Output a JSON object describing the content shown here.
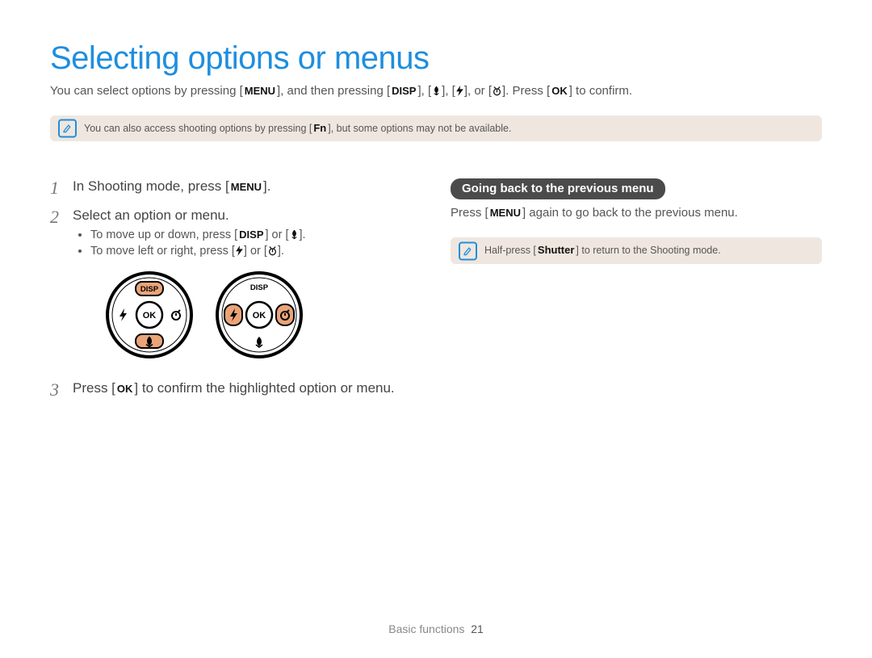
{
  "page": {
    "title": "Selecting options or menus",
    "intro_parts": {
      "p1": "You can select options by pressing [",
      "menu": "MENU",
      "p2": "], and then pressing [",
      "disp": "DISP",
      "p3": "], [",
      "p4": "], [",
      "p5": "], or [",
      "p6": "]. Press [",
      "ok": "OK",
      "p7": "] to confirm."
    }
  },
  "note1": {
    "p1": "You can also access shooting options by pressing [",
    "fn": "Fn",
    "p2": "], but some options may not be available."
  },
  "left": {
    "step1": {
      "num": "1",
      "pre": "In Shooting mode, press [",
      "menu": "MENU",
      "post": "]."
    },
    "step2": {
      "num": "2",
      "text": "Select an option or menu.",
      "b1": {
        "p1": "To move up or down, press [",
        "disp": "DISP",
        "p2": "] or [",
        "p3": "]."
      },
      "b2": {
        "p1": "To move left or right, press [",
        "p2": "] or [",
        "p3": "]."
      }
    },
    "step3": {
      "num": "3",
      "pre": "Press [",
      "ok": "OK",
      "post": "] to confirm the highlighted option or menu."
    }
  },
  "right": {
    "pill": "Going back to the previous menu",
    "text": {
      "p1": "Press [",
      "menu": "MENU",
      "p2": "] again to go back to the previous menu."
    },
    "note": {
      "p1": "Half-press [",
      "shutter": "Shutter",
      "p2": "] to return to the Shooting mode."
    }
  },
  "dial": {
    "disp": "DISP",
    "ok": "OK"
  },
  "footer": {
    "section": "Basic functions",
    "page": "21"
  }
}
